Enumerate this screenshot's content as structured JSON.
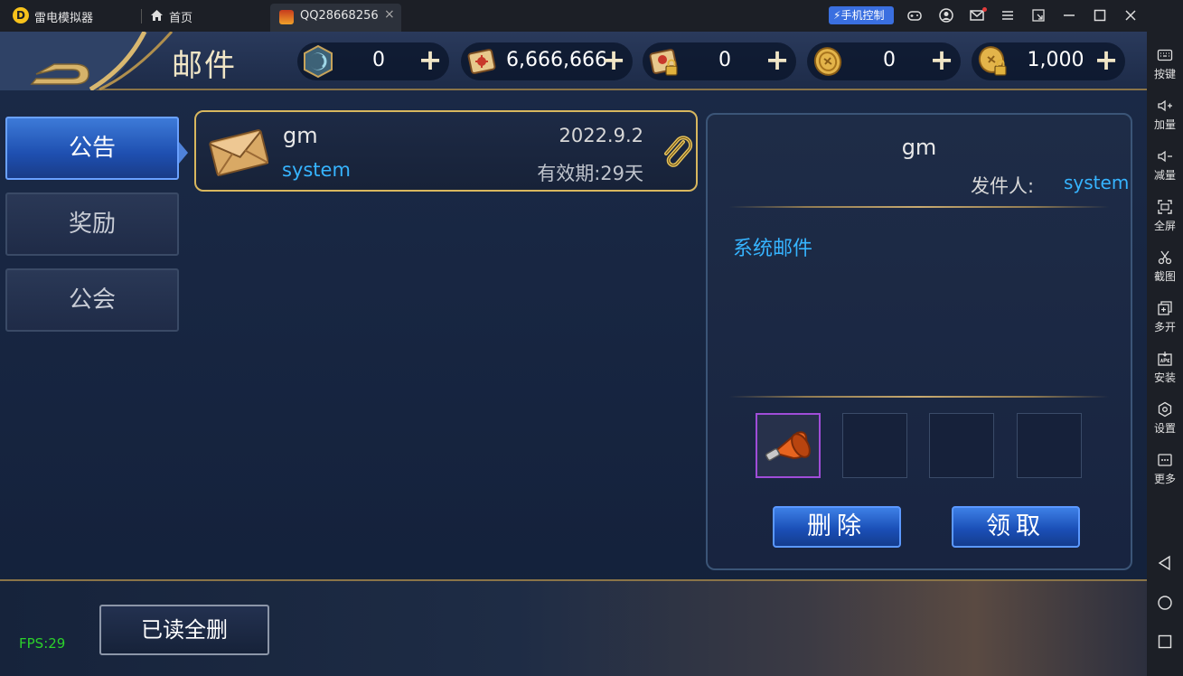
{
  "titlebar": {
    "app_name": "雷电模拟器",
    "home_label": "首页",
    "tab_label": "QQ28668256",
    "tab_close": "×",
    "phone_control": "手机控制"
  },
  "sidebar": {
    "items": [
      {
        "label": "按键",
        "icon": "keyboard-icon"
      },
      {
        "label": "加量",
        "icon": "volume-up-icon"
      },
      {
        "label": "减量",
        "icon": "volume-down-icon"
      },
      {
        "label": "全屏",
        "icon": "fullscreen-icon"
      },
      {
        "label": "截图",
        "icon": "scissors-icon"
      },
      {
        "label": "多开",
        "icon": "multi-instance-icon"
      },
      {
        "label": "安装",
        "icon": "apk-icon"
      },
      {
        "label": "设置",
        "icon": "settings-icon"
      },
      {
        "label": "更多",
        "icon": "more-icon"
      }
    ]
  },
  "game": {
    "page_title": "邮件",
    "resources": [
      {
        "value": "0",
        "icon": "gem-icon"
      },
      {
        "value": "6,666,666",
        "icon": "scroll-icon"
      },
      {
        "value": "0",
        "icon": "locked-scroll-icon"
      },
      {
        "value": "0",
        "icon": "coin-icon"
      },
      {
        "value": "1,000",
        "icon": "locked-coin-icon"
      }
    ],
    "tabs": [
      {
        "label": "公告",
        "active": true
      },
      {
        "label": "奖励",
        "active": false
      },
      {
        "label": "公会",
        "active": false
      }
    ],
    "mail": {
      "sender": "gm",
      "from": "system",
      "date": "2022.9.2",
      "expire": "有效期:29天"
    },
    "detail": {
      "title": "gm",
      "sender_label": "发件人:",
      "sender": "system",
      "body": "系统邮件",
      "delete_label": "删除",
      "claim_label": "领取"
    },
    "read_delete_label": "已读全删",
    "fps": "FPS:29"
  },
  "colors": {
    "accent_blue": "#36b4ff",
    "gold_border": "#d8b75e",
    "fps_green": "#2bd12b"
  }
}
